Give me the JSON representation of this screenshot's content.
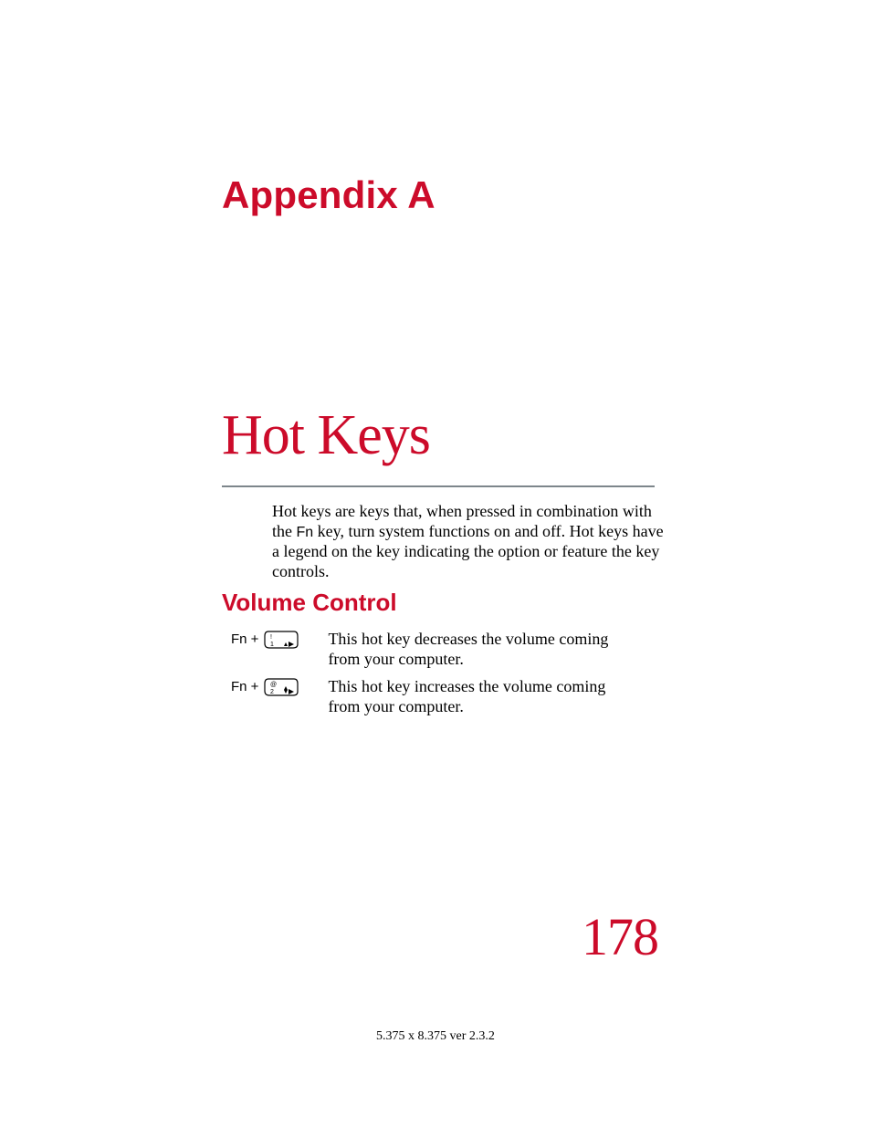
{
  "appendix_label": "Appendix A",
  "title": "Hot Keys",
  "intro": {
    "part1": "Hot keys are keys that, when pressed in combination with the ",
    "fn": "Fn",
    "part2": " key, turn system functions on and off. Hot keys have a legend on the key indicating the option or feature the key controls."
  },
  "section_heading": "Volume Control",
  "rows": [
    {
      "combo": "Fn +",
      "key_top": "!",
      "key_bottom": "1",
      "key_glyph": "▼◄",
      "text": "This hot key decreases the volume coming from your computer."
    },
    {
      "combo": "Fn +",
      "key_top": "@",
      "key_bottom": "2",
      "key_glyph": "▲◄",
      "text": "This hot key increases the volume coming from your computer."
    }
  ],
  "page_number": "178",
  "footer": "5.375 x 8.375 ver 2.3.2"
}
